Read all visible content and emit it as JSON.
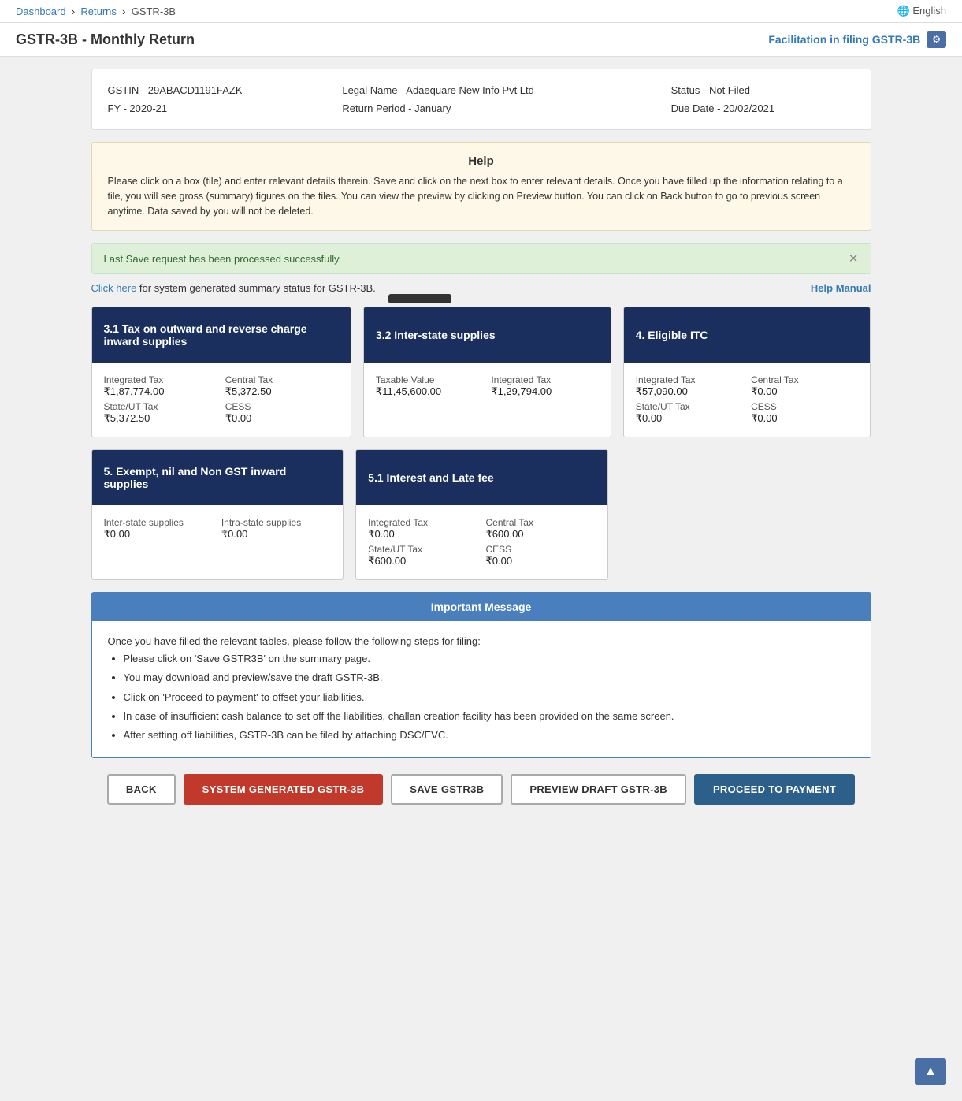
{
  "topbar": {
    "breadcrumb": [
      "Dashboard",
      "Returns",
      "GSTR-3B"
    ],
    "language": "English"
  },
  "header": {
    "title": "GSTR-3B - Monthly Return",
    "facilitation_link": "Facilitation in filing GSTR-3B"
  },
  "info": {
    "gstin_label": "GSTIN - 29ABACD1191FAZK",
    "legal_name_label": "Legal Name - Adaequare New Info Pvt Ltd",
    "status_label": "Status - Not Filed",
    "fy_label": "FY - 2020-21",
    "return_period_label": "Return Period - January",
    "due_date_label": "Due Date - 20/02/2021"
  },
  "help": {
    "title": "Help",
    "text": "Please click on a box (tile) and enter relevant details therein. Save and click on the next box to enter relevant details. Once you have filled up the information relating to a tile, you will see gross (summary) figures on the tiles. You can view the preview by clicking on Preview button. You can click on Back button to go to previous screen anytime. Data saved by you will not be deleted."
  },
  "success_message": "Last Save request has been processed successfully.",
  "summary_bar": {
    "prefix": "Click here",
    "suffix": " for system generated summary status for GSTR-3B.",
    "help_manual": "Help Manual"
  },
  "tiles": [
    {
      "id": "tile-3-1",
      "header": "3.1 Tax on outward and reverse charge inward supplies",
      "fields": [
        {
          "label": "Integrated Tax",
          "value": "₹1,87,774.00"
        },
        {
          "label": "Central Tax",
          "value": "₹5,372.50"
        },
        {
          "label": "State/UT Tax",
          "value": "₹5,372.50"
        },
        {
          "label": "CESS",
          "value": "₹0.00"
        }
      ]
    },
    {
      "id": "tile-3-2",
      "header": "3.2 Inter-state supplies",
      "fields": [
        {
          "label": "Taxable Value",
          "value": "₹11,45,600.00"
        },
        {
          "label": "Integrated Tax",
          "value": "₹1,29,794.00"
        }
      ]
    },
    {
      "id": "tile-4",
      "header": "4. Eligible ITC",
      "fields": [
        {
          "label": "Integrated Tax",
          "value": "₹57,090.00"
        },
        {
          "label": "Central Tax",
          "value": "₹0.00"
        },
        {
          "label": "State/UT Tax",
          "value": "₹0.00"
        },
        {
          "label": "CESS",
          "value": "₹0.00"
        }
      ]
    },
    {
      "id": "tile-5",
      "header": "5. Exempt, nil and Non GST inward supplies",
      "fields": [
        {
          "label": "Inter-state supplies",
          "value": "₹0.00"
        },
        {
          "label": "Intra-state supplies",
          "value": "₹0.00"
        }
      ]
    },
    {
      "id": "tile-5-1",
      "header": "5.1 Interest and Late fee",
      "fields": [
        {
          "label": "Integrated Tax",
          "value": "₹0.00"
        },
        {
          "label": "Central Tax",
          "value": "₹600.00"
        },
        {
          "label": "State/UT Tax",
          "value": "₹600.00"
        },
        {
          "label": "CESS",
          "value": "₹0.00"
        }
      ]
    }
  ],
  "important": {
    "header": "Important Message",
    "intro": "Once you have filled the relevant tables, please follow the following steps for filing:-",
    "points": [
      "Please click on 'Save GSTR3B' on the summary page.",
      "You may download and preview/save the draft GSTR-3B.",
      "Click on 'Proceed to payment' to offset your liabilities.",
      "In case of insufficient cash balance to set off the liabilities, challan creation facility has been provided on the same screen.",
      "After setting off liabilities, GSTR-3B can be filed by attaching DSC/EVC."
    ]
  },
  "buttons": {
    "back": "BACK",
    "system_generated": "SYSTEM GENERATED GSTR-3B",
    "save": "SAVE GSTR3B",
    "preview": "PREVIEW DRAFT GSTR-3B",
    "proceed": "PROCEED TO PAYMENT"
  }
}
